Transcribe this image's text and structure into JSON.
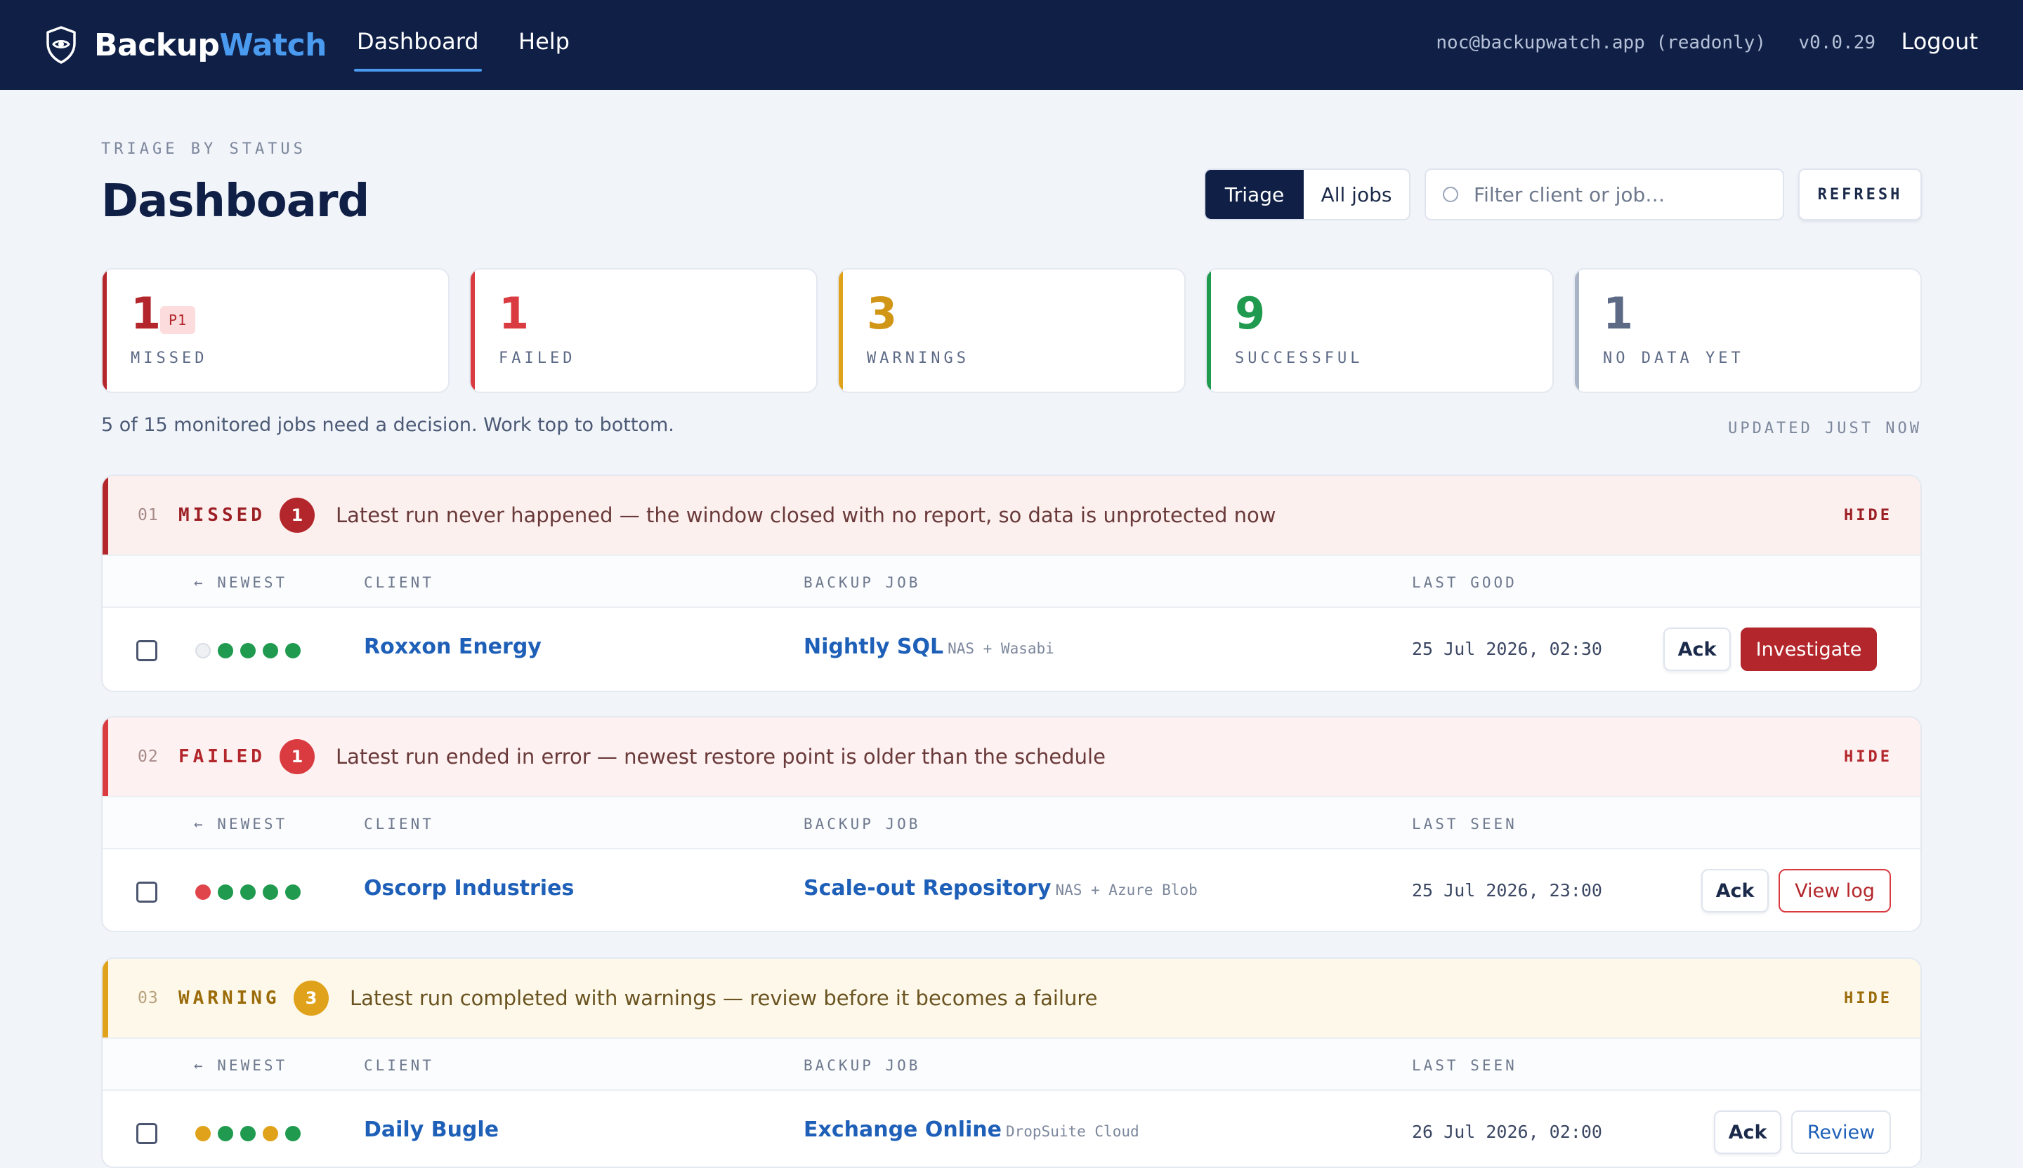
{
  "brand": {
    "name_a": "Backup",
    "name_b": "Watch"
  },
  "nav": {
    "dashboard": "Dashboard",
    "help": "Help"
  },
  "topbar": {
    "user": "noc@backupwatch.app (readonly)",
    "version": "v0.0.29",
    "logout": "Logout"
  },
  "header": {
    "eyebrow": "TRIAGE BY STATUS",
    "title": "Dashboard",
    "view_triage": "Triage",
    "view_all": "All jobs",
    "filter_placeholder": "Filter client or job…",
    "refresh": "REFRESH"
  },
  "stats": {
    "missed": {
      "count": "1",
      "label": "MISSED",
      "badge": "P1"
    },
    "failed": {
      "count": "1",
      "label": "FAILED"
    },
    "warnings": {
      "count": "3",
      "label": "WARNINGS"
    },
    "successful": {
      "count": "9",
      "label": "SUCCESSFUL"
    },
    "nodata": {
      "count": "1",
      "label": "NO DATA YET"
    }
  },
  "summary": "5 of 15 monitored jobs need a decision. Work top to bottom.",
  "updated": "UPDATED JUST NOW",
  "sections": {
    "missed": {
      "index": "01",
      "name": "MISSED",
      "count": "1",
      "description": "Latest run never happened — the window closed with no report, so data is unprotected now",
      "hide": "HIDE",
      "columns": {
        "newest": "← NEWEST",
        "client": "CLIENT",
        "job": "BACKUP JOB",
        "last": "LAST GOOD"
      },
      "rows": [
        {
          "history": [
            "empty",
            "ok",
            "ok",
            "ok",
            "ok"
          ],
          "client": "Roxxon Energy",
          "job": "Nightly SQL",
          "job_meta": "NAS + Wasabi",
          "last": "25 Jul 2026, 02:30",
          "ack": "Ack",
          "action": "Investigate"
        }
      ]
    },
    "failed": {
      "index": "02",
      "name": "FAILED",
      "count": "1",
      "description": "Latest run ended in error — newest restore point is older than the schedule",
      "hide": "HIDE",
      "columns": {
        "newest": "← NEWEST",
        "client": "CLIENT",
        "job": "BACKUP JOB",
        "last": "LAST SEEN"
      },
      "rows": [
        {
          "history": [
            "failed",
            "ok",
            "ok",
            "ok",
            "ok"
          ],
          "client": "Oscorp Industries",
          "job": "Scale-out Repository",
          "job_meta": "NAS + Azure Blob",
          "last": "25 Jul 2026, 23:00",
          "ack": "Ack",
          "action": "View log"
        }
      ]
    },
    "warning": {
      "index": "03",
      "name": "WARNING",
      "count": "3",
      "description": "Latest run completed with warnings — review before it becomes a failure",
      "hide": "HIDE",
      "columns": {
        "newest": "← NEWEST",
        "client": "CLIENT",
        "job": "BACKUP JOB",
        "last": "LAST SEEN"
      },
      "rows": [
        {
          "history": [
            "warning",
            "ok",
            "ok",
            "warning",
            "ok"
          ],
          "client": "Daily Bugle",
          "job": "Exchange Online",
          "job_meta": "DropSuite Cloud",
          "last": "26 Jul 2026, 02:00",
          "ack": "Ack",
          "action": "Review"
        }
      ]
    }
  },
  "colors": {
    "navy": "#0f1f46",
    "accent": "#4a9bf0",
    "missed": "#b3262b",
    "failed": "#d93b40",
    "warning": "#e0a21b",
    "success": "#1f9a4f",
    "nodata": "#a9b4c6"
  },
  "icons": {
    "brand": "shield-eye-icon",
    "filter": "search-circle-icon",
    "checkbox": "checkbox-icon"
  }
}
